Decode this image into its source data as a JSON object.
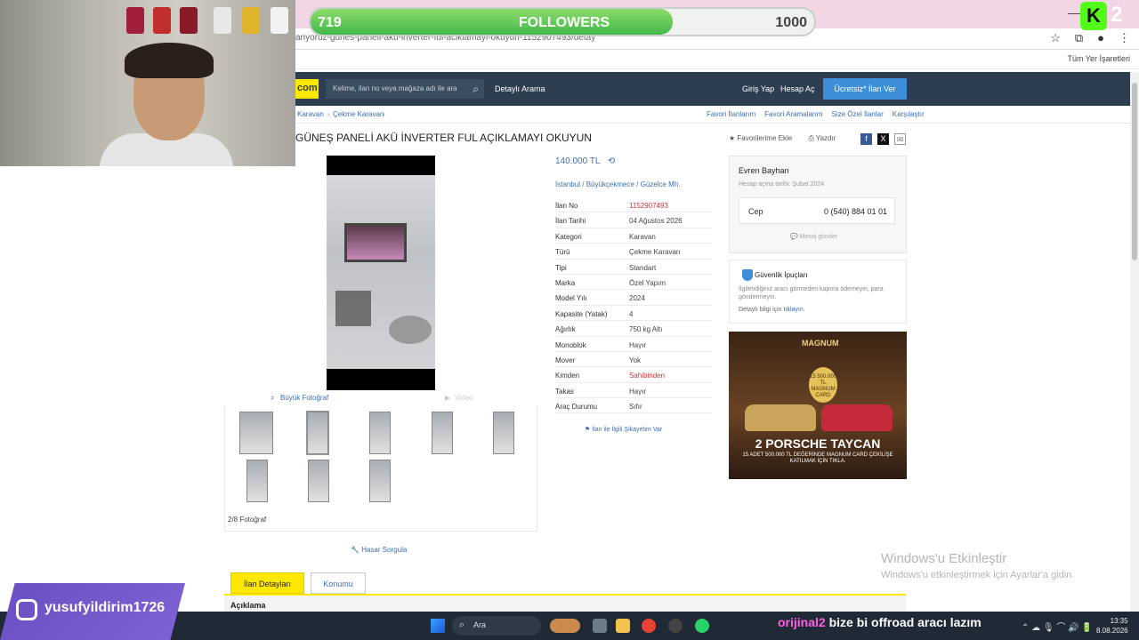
{
  "browser": {
    "url": "anyoruz-gunes-paneli-aku-inverter-ful-aciklamayi-okuyun-1152907493/detay",
    "all_bookmarks": "Tüm Yer İşaretleri",
    "icons": [
      "star-icon",
      "extensions-icon",
      "profile-icon",
      "menu-icon"
    ]
  },
  "header": {
    "logo": "com",
    "search_placeholder": "Kelime, ilan no veya mağaza adı ile ara",
    "detail_search": "Detaylı Arama",
    "login": "Giriş Yap",
    "register": "Hesap Aç",
    "free_ad": "Ücretsiz* İlan Ver"
  },
  "breadcrumb": [
    "Karavan",
    "Çekme Karavan"
  ],
  "top_links": [
    "Favori İlanlarım",
    "Favori Aramalarım",
    "Size Özel İlanlar",
    "Karşılaştır"
  ],
  "listing": {
    "title": "GÜNEŞ PANELİ AKÜ İNVERTER FUL AÇIKLAMAYI OKUYUN",
    "add_fav": "Favorilerime Ekle",
    "print": "Yazdır",
    "price": "140.000 TL",
    "location": "İstanbul / Büyükçekmece / Güzelce Mh.",
    "specs": [
      {
        "k": "İlan No",
        "v": "1152907493",
        "red": true
      },
      {
        "k": "İlan Tarihi",
        "v": "04 Ağustos 2026"
      },
      {
        "k": "Kategori",
        "v": "Karavan"
      },
      {
        "k": "Türü",
        "v": "Çekme Karavan"
      },
      {
        "k": "Tipi",
        "v": "Standart"
      },
      {
        "k": "Marka",
        "v": "Özel Yapım"
      },
      {
        "k": "Model Yılı",
        "v": "2024"
      },
      {
        "k": "Kapasite (Yatak)",
        "v": "4"
      },
      {
        "k": "Ağırlık",
        "v": "750 kg Altı"
      },
      {
        "k": "Monoblok",
        "v": "Hayır"
      },
      {
        "k": "Mover",
        "v": "Yok"
      },
      {
        "k": "Kimden",
        "v": "Sahibinden",
        "red": true
      },
      {
        "k": "Takas",
        "v": "Hayır"
      },
      {
        "k": "Araç Durumu",
        "v": "Sıfır"
      }
    ],
    "complain": "İlan ile İlgili Şikayetim Var",
    "big_photo": "Büyük Fotoğraf",
    "video": "Video",
    "photo_count": "2/8 Fotoğraf",
    "damage_query": "Hasar Sorgula"
  },
  "seller": {
    "name": "Evren Bayhan",
    "since": "Hesap açma tarihi: Şubat 2024",
    "phone_label": "Cep",
    "phone": "0 (540) 884 01 01",
    "send_msg": "Mesaj gönder"
  },
  "safety": {
    "title": "Güvenlik İpuçları",
    "text": "İlgilendiğiniz aracı görmeden kapora ödemeyin, para göndermeyin.",
    "link_prefix": "Detaylı bilgi için",
    "link": "tıklayın."
  },
  "ad": {
    "brand": "MAGNUM",
    "medal": "15 500.000 TL MAGNUM CARD",
    "headline": "2 PORSCHE TAYCAN",
    "sub": "15 ADET 500.000 TL DEĞERİNDE MAGNUM CARD ÇEKİLİŞE KATILMAK İÇİN TIKLA."
  },
  "tabs": {
    "details": "İlan Detayları",
    "location": "Konumu"
  },
  "description_label": "Açıklama",
  "windows": {
    "activate_title": "Windows'u Etkinleştir",
    "activate_sub": "Windows'u etkinleştirmek için Ayarlar'a gidin.",
    "search": "Ara",
    "time": "13:35",
    "date": "8.08.2026"
  },
  "stream": {
    "followers_current": "719",
    "followers_label": "FOLLOWERS",
    "followers_goal": "1000",
    "followers_progress": 0.719,
    "kick_count": "2",
    "instagram": "yusufyildirim1726",
    "chat_user": "orijinal2",
    "chat_text": "bize bi offroad aracı lazım"
  }
}
